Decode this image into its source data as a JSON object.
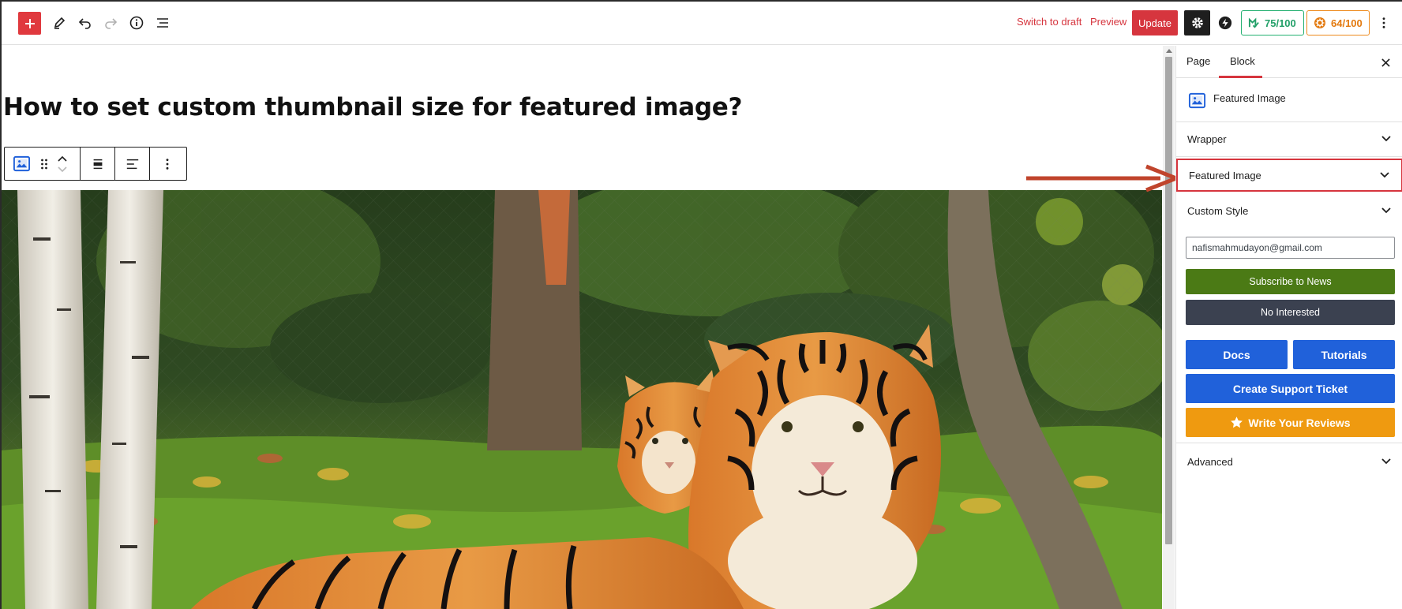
{
  "toolbar": {
    "add_icon": "plus-icon",
    "tools_icon": "pencil-icon",
    "undo_icon": "undo-icon",
    "redo_icon": "redo-icon",
    "details_icon": "info-icon",
    "outline_icon": "list-view-icon",
    "switch_to_draft": "Switch to draft",
    "preview": "Preview",
    "update": "Update",
    "settings_icon": "gear-icon",
    "plugin_icon": "bolt-icon",
    "seo_score": "75/100",
    "readability_score": "64/100",
    "options_icon": "more-vertical-icon",
    "colors": {
      "accent_red": "#d6353e",
      "seo_green": "#23a069",
      "readability_orange": "#e3790d"
    }
  },
  "editor": {
    "post_title": "How to set custom thumbnail size for featured image?",
    "block_toolbar": {
      "block_icon": "featured-image-icon",
      "drag_icon": "drag-handle-icon",
      "move_up_icon": "chevron-up-icon",
      "move_down_icon": "chevron-down-icon",
      "align_icon": "align-center-icon",
      "justify_icon": "justify-left-icon",
      "options_icon": "more-vertical-icon"
    },
    "image_subject": "tiger-photo"
  },
  "sidebar": {
    "tabs": [
      {
        "label": "Page",
        "active": false
      },
      {
        "label": "Block",
        "active": true
      }
    ],
    "close_icon": "close-icon",
    "block_name": "Featured Image",
    "panels": {
      "wrapper": "Wrapper",
      "featured_image": "Featured Image",
      "custom_style": "Custom Style",
      "advanced": "Advanced"
    },
    "subscribe": {
      "email_value": "nafismahmudayon@gmail.com",
      "subscribe_label": "Subscribe to News",
      "no_interest_label": "No Interested"
    },
    "links": {
      "docs": "Docs",
      "tutorials": "Tutorials",
      "support": "Create Support Ticket",
      "reviews": "Write Your Reviews"
    },
    "colors": {
      "blue": "#2061da",
      "green": "#4b7a15",
      "dark": "#3b4150",
      "orange": "#ef9a10"
    }
  }
}
